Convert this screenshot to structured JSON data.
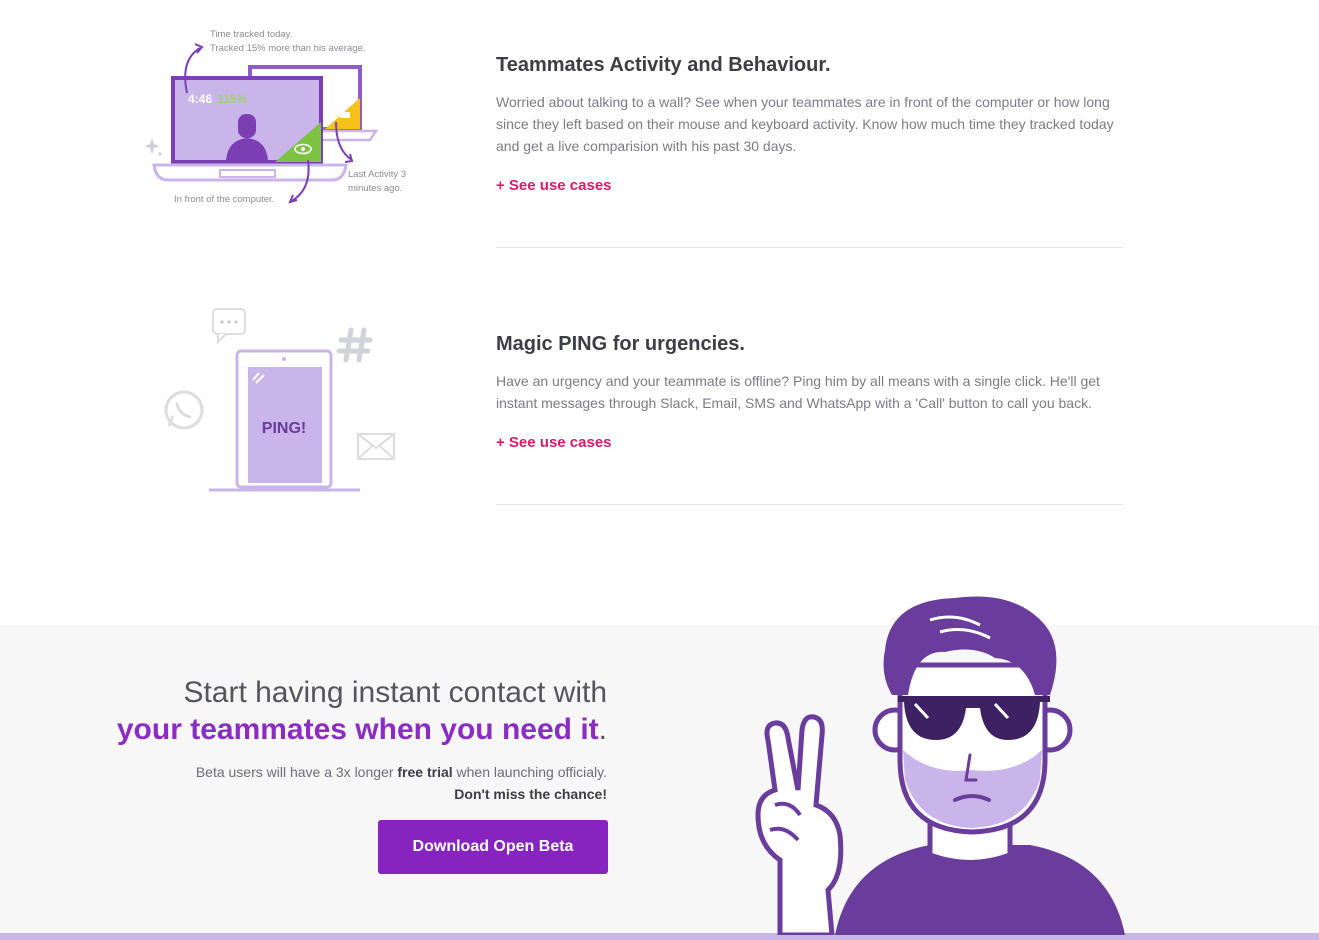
{
  "features": [
    {
      "title": "Teammates Activity and Behaviour.",
      "description": "Worried about talking to a wall? See when your teammates are in front of the computer or how long since they left based on their mouse and keyboard activity. Know how much time they tracked today and get a live comparision with his past 30 days.",
      "link": "+ See use cases",
      "illustration": {
        "time_note_line1": "Time tracked today.",
        "time_note_line2": "Tracked 15% more than his average.",
        "timer": "4:46",
        "percent": "115%",
        "last_activity_line1": "Last Activity 3",
        "last_activity_line2": "minutes ago.",
        "front_note": "In front of the computer."
      }
    },
    {
      "title": "Magic PING for urgencies.",
      "description": "Have an urgency and your teammate is offline? Ping him by all means with a single click. He'll get instant messages through Slack, Email, SMS and WhatsApp with a 'Call' button to call you back.",
      "link": "+ See use cases",
      "illustration": {
        "phone_text": "PING!"
      }
    }
  ],
  "cta": {
    "line1": "Start having instant contact with",
    "line2": "your teammates when you need it",
    "line2_suffix": ".",
    "sub_prefix": "Beta users will have a 3x longer ",
    "sub_bold": "free trial",
    "sub_suffix": " when launching officialy.",
    "sub_line2": "Don't miss the chance!",
    "button": "Download Open Beta"
  },
  "colors": {
    "accent": "#8724c0",
    "link": "#d81b6a",
    "purple_light": "#c9b5ea",
    "purple_dark": "#6a3c9c"
  }
}
